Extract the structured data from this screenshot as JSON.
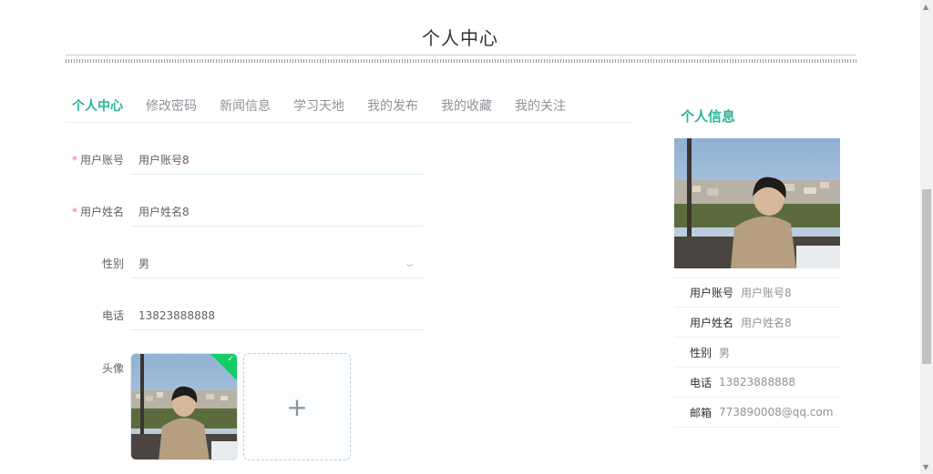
{
  "page": {
    "title": "个人中心"
  },
  "tabs": [
    {
      "label": "个人中心",
      "active": true
    },
    {
      "label": "修改密码",
      "active": false
    },
    {
      "label": "新闻信息",
      "active": false
    },
    {
      "label": "学习天地",
      "active": false
    },
    {
      "label": "我的发布",
      "active": false
    },
    {
      "label": "我的收藏",
      "active": false
    },
    {
      "label": "我的关注",
      "active": false
    }
  ],
  "form": {
    "account": {
      "label": "用户账号",
      "value": "用户账号8",
      "required": true
    },
    "name": {
      "label": "用户姓名",
      "value": "用户姓名8",
      "required": true
    },
    "gender": {
      "label": "性别",
      "value": "男"
    },
    "phone": {
      "label": "电话",
      "value": "13823888888"
    },
    "avatar": {
      "label": "头像"
    },
    "required_mark": "*"
  },
  "info": {
    "title": "个人信息",
    "rows": [
      {
        "key": "用户账号",
        "value": "用户账号8"
      },
      {
        "key": "用户姓名",
        "value": "用户姓名8"
      },
      {
        "key": "性别",
        "value": "男"
      },
      {
        "key": "电话",
        "value": "13823888888"
      },
      {
        "key": "邮箱",
        "value": "773890008@qq.com"
      }
    ]
  },
  "icons": {
    "upload_add": "plus-icon",
    "uploaded": "check-icon",
    "select": "chevron-down-icon"
  },
  "colors": {
    "accent": "#2bb598",
    "required": "#f56c6c",
    "success": "#13ce66"
  }
}
